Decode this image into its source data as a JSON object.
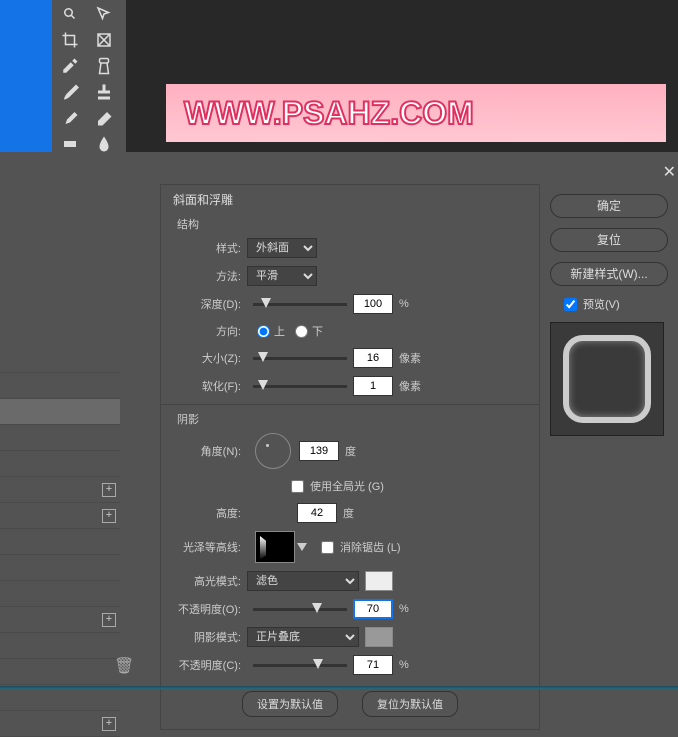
{
  "banner_text": "WWW.PSAHZ.COM",
  "dialog": {
    "bevel_title": "斜面和浮雕",
    "structure_title": "结构",
    "style_label": "样式:",
    "style_value": "外斜面",
    "technique_label": "方法:",
    "technique_value": "平滑",
    "depth_label": "深度(D):",
    "depth_value": "100",
    "percent": "%",
    "direction_label": "方向:",
    "direction_up": "上",
    "direction_down": "下",
    "size_label": "大小(Z):",
    "size_value": "16",
    "pixels": "像素",
    "soften_label": "软化(F):",
    "soften_value": "1",
    "shadow_title": "阴影",
    "angle_label": "角度(N):",
    "angle_value": "139",
    "degrees": "度",
    "global_light": "使用全局光 (G)",
    "altitude_label": "高度:",
    "altitude_value": "42",
    "gloss_label": "光泽等高线:",
    "antialias": "消除锯齿 (L)",
    "highlight_mode_label": "高光模式:",
    "highlight_mode_value": "滤色",
    "opacity_o_label": "不透明度(O):",
    "opacity_o_value": "70",
    "shadow_mode_label": "阴影模式:",
    "shadow_mode_value": "正片叠底",
    "opacity_c_label": "不透明度(C):",
    "opacity_c_value": "71",
    "set_default": "设置为默认值",
    "reset_default": "复位为默认值"
  },
  "right": {
    "ok": "确定",
    "cancel": "复位",
    "new_style": "新建样式(W)...",
    "preview": "预览(V)"
  },
  "style_rows_plus": [
    2,
    3,
    7,
    10
  ]
}
